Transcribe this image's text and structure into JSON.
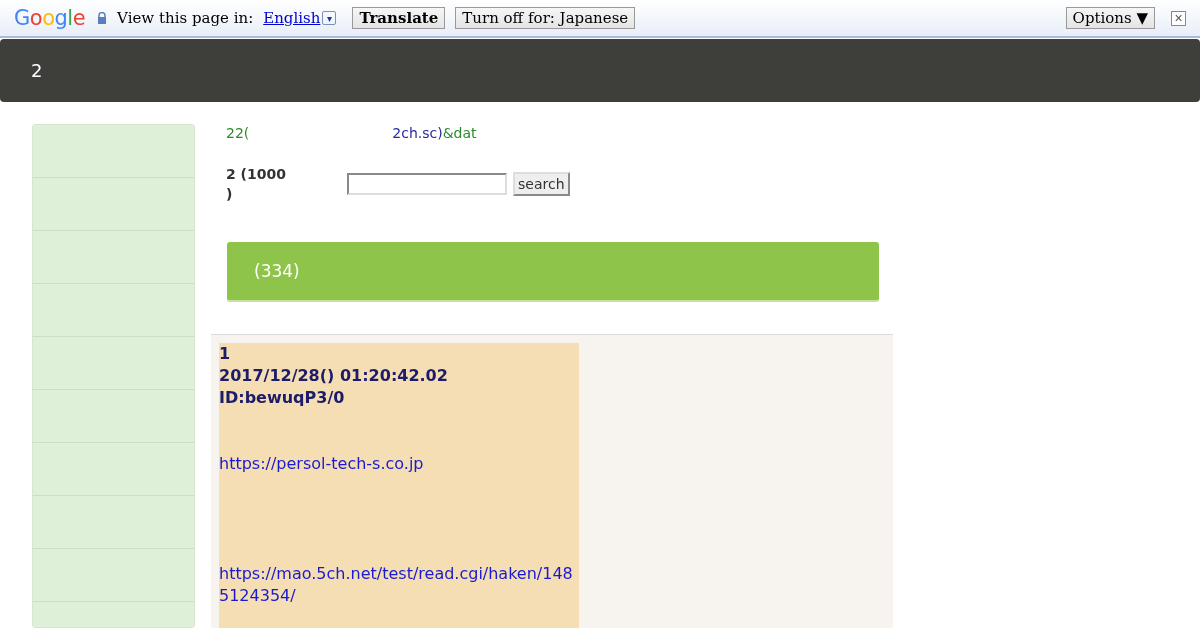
{
  "translate_bar": {
    "logo": "Google",
    "prompt": "View this page in:",
    "language": "English",
    "dropdown": "▾",
    "translate_button": "Translate",
    "turn_off_button": "Turn off for: Japanese",
    "options_button": "Options ▼",
    "close": "×"
  },
  "header": {
    "title": "2"
  },
  "intro": [
    {
      "text": "22(",
      "kind": "plain"
    },
    {
      "text": "2ch.sc)",
      "kind": "link"
    },
    {
      "text": "&dat",
      "kind": "plain"
    }
  ],
  "search": {
    "label": "2 (1000\n)",
    "button": "search"
  },
  "thread_bar": {
    "title": "(334)"
  },
  "posts": [
    {
      "number": "1",
      "date": "2017/12/28() 01:20:42.02",
      "id": "ID:bewuqP3/0",
      "links": [
        "https://persol-tech-s.co.jp",
        "https://mao.5ch.net/test/read.cgi/haken/1485124354/"
      ]
    }
  ]
}
